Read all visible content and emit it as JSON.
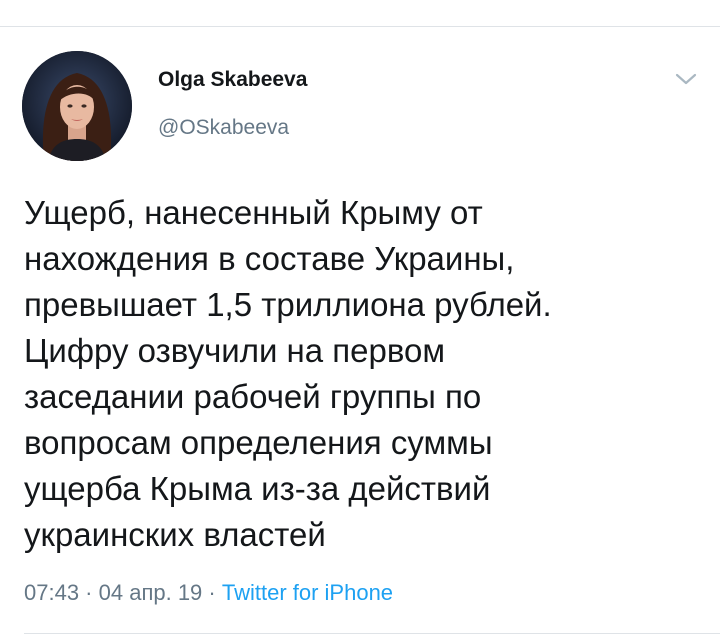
{
  "tweet": {
    "author": {
      "display_name": "Olga Skabeeva",
      "handle": "@OSkabeeva",
      "avatar_icon": "user-avatar"
    },
    "menu_icon": "chevron-down-icon",
    "text": "Ущерб, нанесенный Крыму от\nнахождения в составе Украины,\nпревышает 1,5 триллиона рублей.\nЦифру озвучили на первом\nзаседании рабочей группы по\nвопросам определения суммы\nущерба Крыма из-за действий\nукраинских властей",
    "time": "07:43",
    "separator": " · ",
    "date": "04 апр. 19",
    "source": "Twitter for iPhone"
  },
  "colors": {
    "text_primary": "#14171a",
    "text_secondary": "#657786",
    "link": "#1da1f2",
    "divider": "#dfe3e7"
  }
}
